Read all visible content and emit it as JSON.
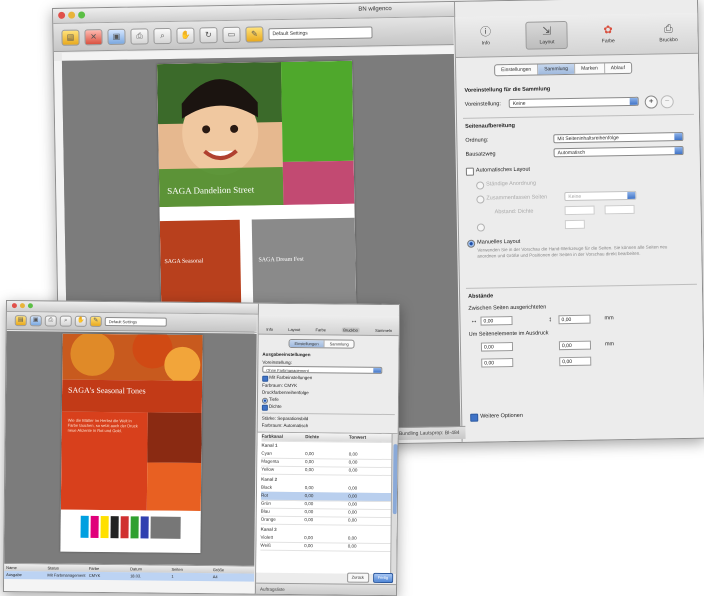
{
  "back_window": {
    "title": "BN wilgenco",
    "toolbar": {
      "settings_select": "Default Settings"
    },
    "panel_tabs": [
      {
        "label": "Info",
        "icon": "info-icon"
      },
      {
        "label": "Layout",
        "icon": "layout-icon"
      },
      {
        "label": "Farbe",
        "icon": "color-wheel-icon"
      },
      {
        "label": "Bruckbo",
        "icon": "printer-icon"
      }
    ],
    "sub_tabs": [
      "Einstellungen",
      "Sammlung",
      "Marken",
      "Ablauf"
    ],
    "heading_collection": "Voreinstellung für die Sammlung",
    "preset_label": "Voreinstellung:",
    "preset_value": "Keine",
    "heading_arrange": "Seitenaufbereitung",
    "order_label": "Ordnung:",
    "order_value": "Mit Seiteninhaltsreihenfolge",
    "direction_label": "Bausatzweg",
    "direction_value": "Automatisch",
    "auto_layout_label": "Automatisches Layout",
    "auto_option_1": "Ständige Anordnung",
    "auto_option_2": "Zusammenfassen Seiten",
    "auto_option_3": "Abstand: Dichte",
    "manual_layout_label": "Manuelles Layout",
    "manual_layout_desc": "Verwenden Sie in der Vorschau die Hand-Werkzeuge für die Seiten. Sie können alle Seiten neu anordnen und Größe und Positionen der Seiten in der Vorschau direkt bearbeiten.",
    "heading_distance": "Abstände",
    "spacing_label": "Zwischen Seiten ausgerichteten",
    "spacing_h": "0,00",
    "spacing_v": "0,00",
    "margin_label": "Um Seitenelemente im Ausdruck",
    "margins": [
      "0,00",
      "0,00",
      "0,00",
      "0,00"
    ],
    "unit": "mm",
    "more_options_label": "Weitere Optionen",
    "status_text": "Anordnung der Bundling    Lautsprop: BI-484"
  },
  "back_page": {
    "hero_caption": "SAGA Dandelion Street",
    "card_left_caption": "SAGA Seasonal",
    "card_right_caption": "SAGA Dream Fest"
  },
  "front_window": {
    "toolbar": {
      "settings_select": "Default Settings"
    },
    "panel_tabs": [
      "Info",
      "Layout",
      "Farbe",
      "Bruckbo",
      "Sammeln"
    ],
    "sub_tabs": [
      "Einstellungen",
      "Sammlung"
    ],
    "lines": [
      "Ausgabeeinstellungen",
      "Voreinstellung:",
      "Mit Farbeinstellungen",
      "Farbraum: CMYK",
      "Druckfarbenreihenfolge",
      "Tiefe",
      "Dichte"
    ],
    "color_settings_value": "Ohne Farbmanagement",
    "info_rows": [
      "Stärke:        Separationsbild",
      "Farbraum:      Automatisch"
    ],
    "table_header": [
      "Farbkanal",
      "Dichte",
      "Tonwert"
    ],
    "groups": [
      "Kanal 1",
      "Kanal 2",
      "Kanal 3"
    ],
    "rows": [
      [
        "Cyan",
        "0,00",
        "0,00"
      ],
      [
        "Magenta",
        "0,00",
        "0,00"
      ],
      [
        "Yellow",
        "0,00",
        "0,00"
      ],
      [
        "Black",
        "0,00",
        "0,00"
      ],
      [
        "Rot",
        "0,00",
        "0,00"
      ],
      [
        "Grün",
        "0,00",
        "0,00"
      ],
      [
        "Blau",
        "0,00",
        "0,00"
      ],
      [
        "Orange",
        "0,00",
        "0,00"
      ],
      [
        "Violett",
        "0,00",
        "0,00"
      ],
      [
        "Weiß",
        "0,00",
        "0,00"
      ]
    ],
    "status_text": "Auftragsliste",
    "bottom_buttons": [
      "Zurück",
      "Fertig"
    ]
  },
  "front_page": {
    "title": "SAGA's Seasonal Tones",
    "body": "Wie die Blätter im Herbst die Welt in Farbe tauchen, so setzt auch der Druck neue Akzente in Rot und Gold."
  },
  "job_list": {
    "headers": [
      "Name",
      "Status",
      "Farbe",
      "Datum",
      "Seiten",
      "Größe"
    ],
    "row": [
      "Ausgabe",
      "Mit Farbmanagement",
      "CMYK",
      "18.03.",
      "1",
      "A4"
    ]
  },
  "colors": {
    "accent": "#3f73c7",
    "hero_green": "#3a8a20",
    "autumn_red": "#c23a17"
  }
}
